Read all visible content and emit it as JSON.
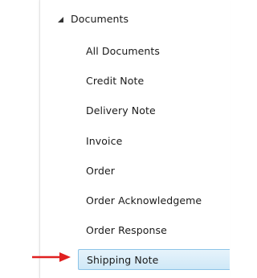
{
  "tree": {
    "root_label": "Documents",
    "items": [
      {
        "label": "All Documents"
      },
      {
        "label": "Credit Note"
      },
      {
        "label": "Delivery Note"
      },
      {
        "label": "Invoice"
      },
      {
        "label": "Order"
      },
      {
        "label": "Order Acknowledgeme"
      },
      {
        "label": "Order Response"
      },
      {
        "label": "Shipping Note",
        "selected": true
      }
    ]
  },
  "annotation": {
    "arrow_color": "#e02020"
  }
}
